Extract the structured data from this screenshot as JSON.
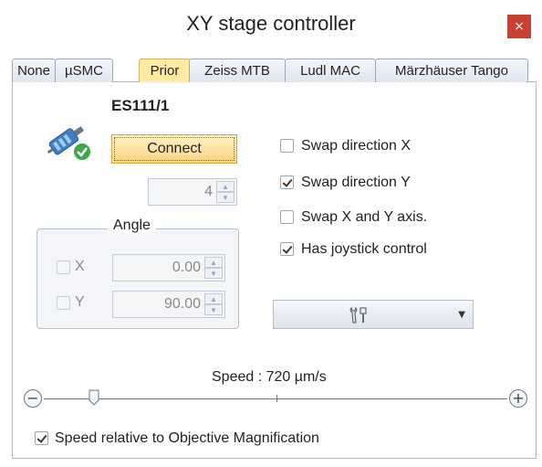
{
  "window": {
    "title": "XY stage controller",
    "close_glyph": "×",
    "close_color": "#c84031"
  },
  "tabs": [
    {
      "label": "None",
      "active": false
    },
    {
      "label": "µSMC",
      "active": false
    },
    {
      "label": "Prior",
      "active": true
    },
    {
      "label": "Zeiss MTB",
      "active": false
    },
    {
      "label": "Ludl MAC",
      "active": false
    },
    {
      "label": "Märzhäuser Tango",
      "active": false
    }
  ],
  "device": {
    "name": "ES111/1",
    "icon": "plug-connected-icon",
    "connect_label": "Connect",
    "port_value": "4"
  },
  "angle": {
    "legend": "Angle",
    "x_label": "X",
    "x_value": "0.00",
    "y_label": "Y",
    "y_value": "90.00"
  },
  "options": [
    {
      "label": "Swap direction X",
      "checked": false
    },
    {
      "label": "Swap direction Y",
      "checked": true
    },
    {
      "label": "Swap X and Y axis.",
      "checked": false
    },
    {
      "label": "Has joystick control",
      "checked": true
    }
  ],
  "tools_dropdown": {
    "icon": "tools-icon",
    "arrow": "▼"
  },
  "speed": {
    "label": "Speed : 720 µm/s",
    "minus_glyph": "−",
    "plus_glyph": "+"
  },
  "relative": {
    "label": "Speed relative to Objective Magnification",
    "checked": true
  },
  "colors": {
    "active_tab": "#ffe9a3",
    "connect_button": "#fbd47e"
  }
}
